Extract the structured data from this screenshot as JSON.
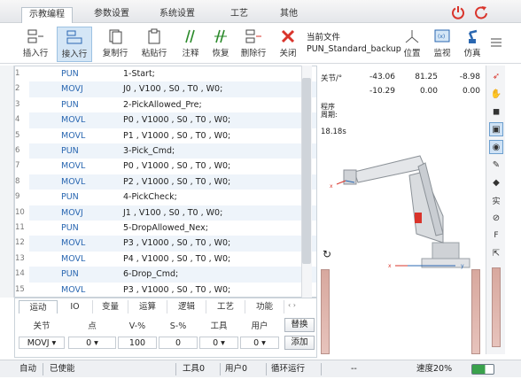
{
  "tabs": [
    "示教编程",
    "参数设置",
    "系统设置",
    "工艺",
    "其他"
  ],
  "toolbar": {
    "items": [
      "插入行",
      "接入行",
      "复制行",
      "粘贴行",
      "注释",
      "恢复",
      "删除行",
      "关闭"
    ],
    "file_label": "当前文件",
    "file_name": "PUN_Standard_backup",
    "right_items": [
      "位置",
      "监视",
      "仿真"
    ]
  },
  "code_rows": [
    {
      "n": "1",
      "op": "PUN",
      "arg": "1-Start;"
    },
    {
      "n": "2",
      "op": "MOVJ",
      "arg": "J0 , V100 , S0 , T0 , W0;"
    },
    {
      "n": "3",
      "op": "PUN",
      "arg": "2-PickAllowed_Pre;"
    },
    {
      "n": "4",
      "op": "MOVL",
      "arg": "P0 , V1000 , S0 , T0 , W0;"
    },
    {
      "n": "5",
      "op": "MOVL",
      "arg": "P1 , V1000 , S0 , T0 , W0;"
    },
    {
      "n": "6",
      "op": "PUN",
      "arg": "3-Pick_Cmd;"
    },
    {
      "n": "7",
      "op": "MOVL",
      "arg": "P0 , V1000 , S0 , T0 , W0;"
    },
    {
      "n": "8",
      "op": "MOVL",
      "arg": "P2 , V1000 , S0 , T0 , W0;"
    },
    {
      "n": "9",
      "op": "PUN",
      "arg": "4-PickCheck;"
    },
    {
      "n": "10",
      "op": "MOVJ",
      "arg": "J1 , V100 , S0 , T0 , W0;"
    },
    {
      "n": "11",
      "op": "PUN",
      "arg": "5-DropAllowed_Nex;"
    },
    {
      "n": "12",
      "op": "MOVL",
      "arg": "P3 , V1000 , S0 , T0 , W0;"
    },
    {
      "n": "13",
      "op": "MOVL",
      "arg": "P4 , V1000 , S0 , T0 , W0;"
    },
    {
      "n": "14",
      "op": "PUN",
      "arg": "6-Drop_Cmd;"
    },
    {
      "n": "15",
      "op": "MOVL",
      "arg": "P3 , V1000 , S0 , T0 , W0;"
    }
  ],
  "bottom_tabs": [
    "运动",
    "IO",
    "变量",
    "运算",
    "逻辑",
    "工艺",
    "功能"
  ],
  "bottom_headers": [
    "关节",
    "点",
    "V-%",
    "S-%",
    "工具",
    "用户"
  ],
  "bottom_values": {
    "joint": "MOVJ",
    "point": "0",
    "v": "100",
    "s": "0",
    "tool": "0",
    "user": "0"
  },
  "bottom_buttons": [
    "替换",
    "添加"
  ],
  "right_panel": {
    "joint_label": "关节/°",
    "r1": [
      "-43.06",
      "81.25",
      "-8.98"
    ],
    "r2": [
      "-10.29",
      "0.00",
      "0.00"
    ],
    "cycle_label": "程序\n周期:",
    "cycle_time": "18.18s"
  },
  "status": {
    "items": [
      "自动",
      "已使能",
      "工具0",
      "用户0",
      "循环运行",
      "--",
      "速度20%"
    ]
  },
  "colors": {
    "accent_blue": "#2a67b1",
    "alert_red": "#d9342b",
    "robot_gray": "#cfd2d6"
  }
}
